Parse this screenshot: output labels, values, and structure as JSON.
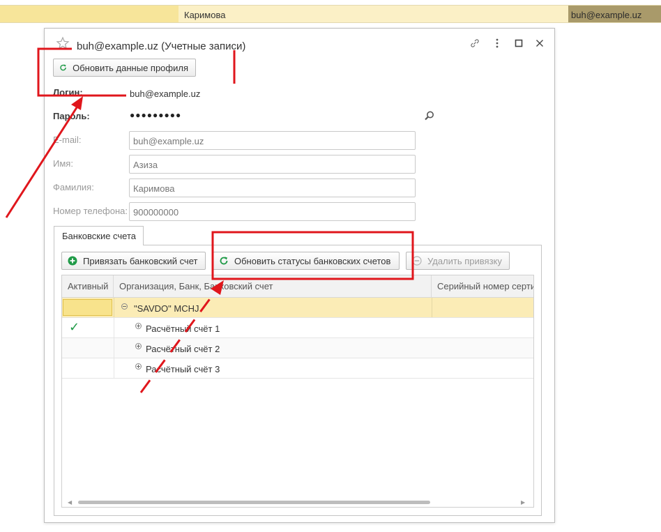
{
  "background_row": {
    "name": "Каримова",
    "email": "buh@example.uz"
  },
  "dialog": {
    "title": "buh@example.uz (Учетные записи)",
    "refresh_profile_label": "Обновить данные профиля",
    "login_label": "Логин:",
    "login_value": "buh@example.uz",
    "password_label": "Пароль:",
    "password_value": "●●●●●●●●●",
    "email_label": "E-mail:",
    "email_value": "buh@example.uz",
    "first_name_label": "Имя:",
    "first_name_value": "Азиза",
    "last_name_label": "Фамилия:",
    "last_name_value": "Каримова",
    "phone_label": "Номер телефона:",
    "phone_value": "900000000",
    "tab_label": "Банковские счета",
    "toolbar": {
      "link_account_label": "Привязать банковский счет",
      "refresh_statuses_label": "Обновить статусы банковских счетов",
      "remove_link_label": "Удалить привязку"
    },
    "grid": {
      "columns": [
        "Активный",
        "Организация, Банк, Банковский счет",
        "Серийный номер серти"
      ],
      "rows": [
        {
          "active": "",
          "text": "\"SAVDO\" MCHJ"
        },
        {
          "active": "✓",
          "text": "Расчётный счёт 1"
        },
        {
          "active": "",
          "text": "Расчётный счёт 2"
        },
        {
          "active": "",
          "text": "Расчётный счёт 3"
        }
      ]
    }
  },
  "colors": {
    "accent_green": "#1f9a47",
    "annotation_red": "#e0161c",
    "selection_yellow": "#fbecb6"
  },
  "icons": [
    "star-icon",
    "link-icon",
    "more-icon",
    "maximize-icon",
    "close-icon",
    "refresh-icon",
    "add-icon",
    "remove-icon",
    "search-icon",
    "checkmark-icon"
  ]
}
